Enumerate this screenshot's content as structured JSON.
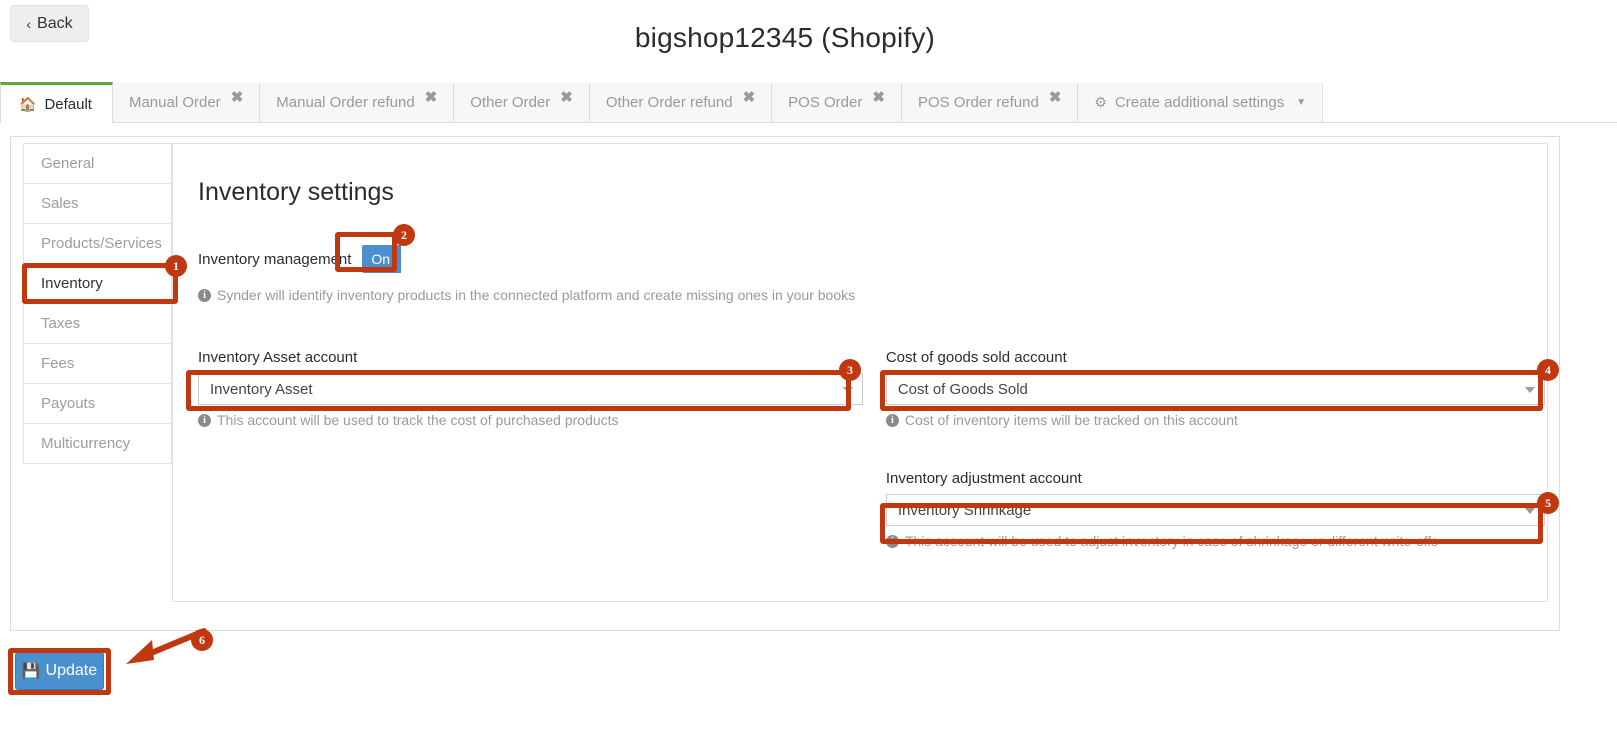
{
  "header": {
    "back_label": "Back",
    "back_icon": "chevron-left-icon",
    "title": "bigshop12345 (Shopify)"
  },
  "tabs": [
    {
      "label": "Default",
      "icon": "home-icon",
      "active": true,
      "closable": false
    },
    {
      "label": "Manual Order",
      "active": false,
      "closable": true
    },
    {
      "label": "Manual Order refund",
      "active": false,
      "closable": true
    },
    {
      "label": "Other Order",
      "active": false,
      "closable": true
    },
    {
      "label": "Other Order refund",
      "active": false,
      "closable": true
    },
    {
      "label": "POS Order",
      "active": false,
      "closable": true
    },
    {
      "label": "POS Order refund",
      "active": false,
      "closable": true
    },
    {
      "label": "Create additional settings",
      "icon": "gear-icon",
      "active": false,
      "closable": false,
      "dropdown": true
    }
  ],
  "sidebar": {
    "items": [
      {
        "label": "General",
        "active": false
      },
      {
        "label": "Sales",
        "active": false
      },
      {
        "label": "Products/Services",
        "active": false
      },
      {
        "label": "Inventory",
        "active": true
      },
      {
        "label": "Taxes",
        "active": false
      },
      {
        "label": "Fees",
        "active": false
      },
      {
        "label": "Payouts",
        "active": false
      },
      {
        "label": "Multicurrency",
        "active": false
      }
    ]
  },
  "main": {
    "section_title": "Inventory settings",
    "inventory_management": {
      "label": "Inventory management",
      "toggle_value": "On",
      "help": "Synder will identify inventory products in the connected platform and create missing ones in your books"
    },
    "fields": {
      "inventory_asset": {
        "label": "Inventory Asset account",
        "value": "Inventory Asset",
        "help": "This account will be used to track the cost of purchased products"
      },
      "cogs": {
        "label": "Cost of goods sold account",
        "value": "Cost of Goods Sold",
        "help": "Cost of inventory items will be tracked on this account"
      },
      "inventory_adjustment": {
        "label": "Inventory adjustment account",
        "value": "Inventory Shrinkage",
        "help": "This account will be used to adjust inventory in case of shrinkage or different write-offs"
      }
    }
  },
  "footer": {
    "update_label": "Update",
    "update_icon": "save-floppy-icon"
  },
  "annotations": {
    "accent_color": "#c0380f",
    "markers": [
      {
        "number": "1",
        "target": "sidebar-item-inventory"
      },
      {
        "number": "2",
        "target": "inventory-management-toggle"
      },
      {
        "number": "3",
        "target": "inventory-asset-select"
      },
      {
        "number": "4",
        "target": "cost-of-goods-sold-select"
      },
      {
        "number": "5",
        "target": "inventory-adjustment-select"
      },
      {
        "number": "6",
        "target": "update-button"
      }
    ]
  }
}
